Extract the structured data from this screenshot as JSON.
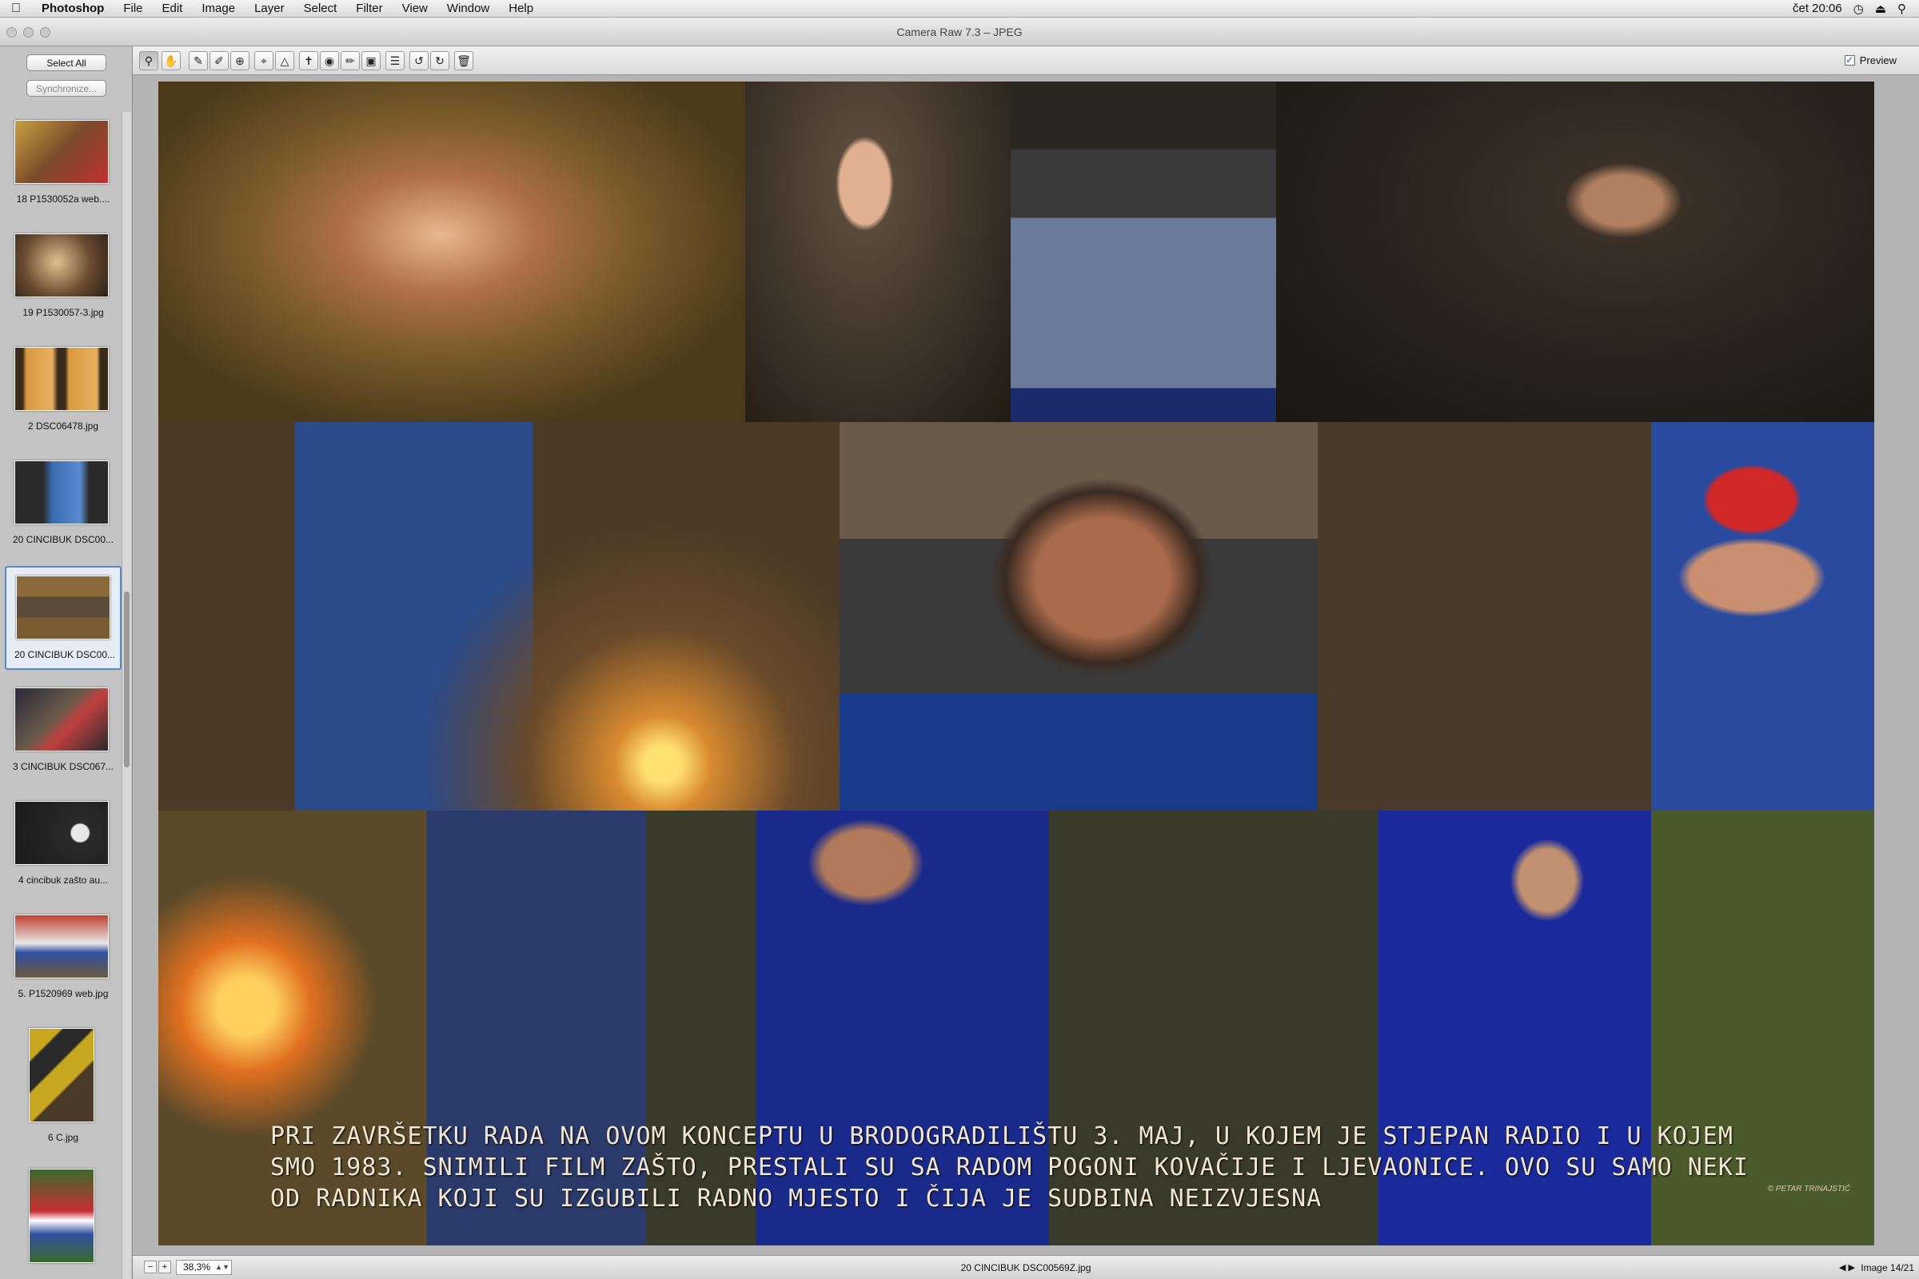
{
  "menubar": {
    "app": "Photoshop",
    "items": [
      "File",
      "Edit",
      "Image",
      "Layer",
      "Select",
      "Filter",
      "View",
      "Window",
      "Help"
    ],
    "clock": "čet 20:06"
  },
  "window": {
    "title": "Camera Raw 7.3  –  JPEG"
  },
  "filmstrip": {
    "select_all": "Select All",
    "synchronize": "Synchronize...",
    "items": [
      {
        "label": "18 P1530052a web...."
      },
      {
        "label": "19 P1530057-3.jpg"
      },
      {
        "label": "2 DSC06478.jpg"
      },
      {
        "label": "20 CINCIBUK DSC00..."
      },
      {
        "label": "20 CINCIBUK DSC00..."
      },
      {
        "label": "3 CINCIBUK DSC067..."
      },
      {
        "label": "4 cincibuk zašto au..."
      },
      {
        "label": "5. P1520969 web.jpg"
      },
      {
        "label": "6 C.jpg"
      },
      {
        "label": ""
      }
    ]
  },
  "toolbar": {
    "tools": [
      "zoom-icon",
      "hand-icon",
      "white-balance-icon",
      "color-sampler-icon",
      "target-adjust-icon",
      "crop-icon",
      "straighten-icon",
      "spot-removal-icon",
      "red-eye-icon",
      "adjustment-brush-icon",
      "graduated-filter-icon",
      "preferences-icon",
      "rotate-ccw-icon",
      "rotate-cw-icon",
      "trash-icon"
    ],
    "preview_label": "Preview"
  },
  "image": {
    "caption_lines": [
      "PRI ZAVRŠETKU RADA NA OVOM KONCEPTU U BRODOGRADILIŠTU 3. MAJ, U KOJEM JE STJEPAN RADIO I U KOJEM",
      "SMO 1983. SNIMILI FILM ZAŠTO, PRESTALI SU SA RADOM POGONI KOVAČIJE I LJEVAONICE. OVO SU SAMO NEKI",
      "OD RADNIKA KOJI SU IZGUBILI RADNO MJESTO I ČIJA JE SUDBINA NEIZVJESNA"
    ],
    "signature": "© PETAR TRINAJSTIĆ"
  },
  "statusbar": {
    "zoom": "38,3%",
    "filename": "20 CINCIBUK DSC00569Z.jpg",
    "count": "Image 14/21"
  }
}
